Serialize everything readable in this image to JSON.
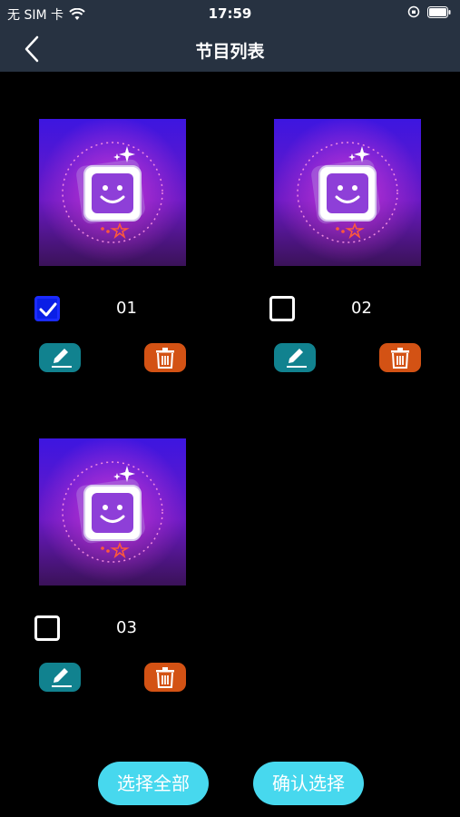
{
  "status_bar": {
    "carrier": "无 SIM 卡",
    "time": "17:59"
  },
  "nav": {
    "title": "节目列表"
  },
  "items": [
    {
      "label": "01",
      "checked": true
    },
    {
      "label": "02",
      "checked": false
    },
    {
      "label": "03",
      "checked": false
    }
  ],
  "footer": {
    "select_all": "选择全部",
    "confirm": "确认选择"
  },
  "colors": {
    "header_bg": "#273241",
    "accent": "#47d8ee",
    "edit": "#11828f",
    "delete": "#d35214",
    "check": "#0a1fe6"
  }
}
